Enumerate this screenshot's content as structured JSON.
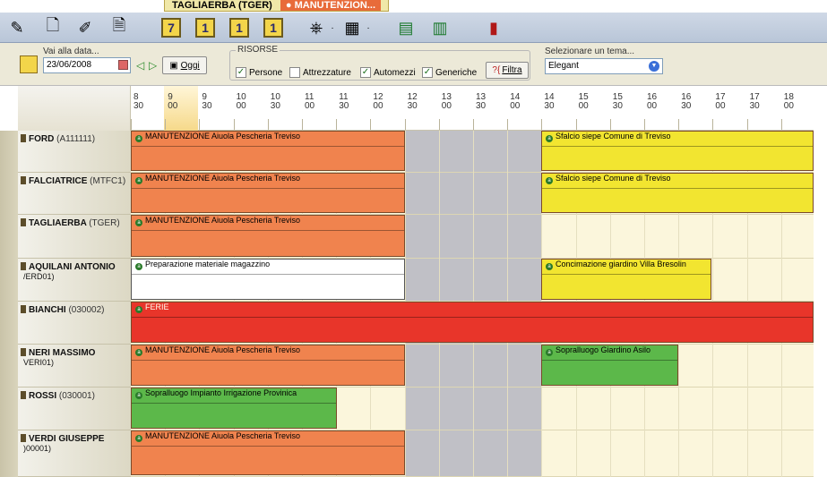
{
  "drag_tab": {
    "resource": "TAGLIAERBA (TGER)",
    "event": "MANUTENZION..."
  },
  "toolbar": {
    "icons": [
      "notepad-icon",
      "new-icon",
      "edit-icon",
      "page-icon",
      "view-week-icon",
      "view-day-icon",
      "view-day-split-icon",
      "view-day-list-icon",
      "network-icon",
      "grid-view-icon",
      "export-excel-icon",
      "excel-sheet-icon",
      "exit-door-icon"
    ],
    "week_label": "7",
    "day_label": "1"
  },
  "filter": {
    "goto_label": "Vai alla data...",
    "date_value": "23/06/2008",
    "today_label": "Oggi",
    "risorse_title": "RISORSE",
    "checks": [
      {
        "label": "Persone",
        "checked": true
      },
      {
        "label": "Attrezzature",
        "checked": false
      },
      {
        "label": "Automezzi",
        "checked": true
      },
      {
        "label": "Generiche",
        "checked": true
      }
    ],
    "filter_label": "Filtra",
    "theme_label": "Selezionare un tema...",
    "theme_value": "Elegant"
  },
  "times": [
    {
      "h": "8",
      "m": "30"
    },
    {
      "h": "9",
      "m": "00"
    },
    {
      "h": "9",
      "m": "30"
    },
    {
      "h": "10",
      "m": "00"
    },
    {
      "h": "10",
      "m": "30"
    },
    {
      "h": "11",
      "m": "00"
    },
    {
      "h": "11",
      "m": "30"
    },
    {
      "h": "12",
      "m": "00"
    },
    {
      "h": "12",
      "m": "30"
    },
    {
      "h": "13",
      "m": "00"
    },
    {
      "h": "13",
      "m": "30"
    },
    {
      "h": "14",
      "m": "00"
    },
    {
      "h": "14",
      "m": "30"
    },
    {
      "h": "15",
      "m": "00"
    },
    {
      "h": "15",
      "m": "30"
    },
    {
      "h": "16",
      "m": "00"
    },
    {
      "h": "16",
      "m": "30"
    },
    {
      "h": "17",
      "m": "00"
    },
    {
      "h": "17",
      "m": "30"
    },
    {
      "h": "18",
      "m": "00"
    }
  ],
  "resources": [
    {
      "name": "FORD",
      "code": "(A111111)",
      "sub": ""
    },
    {
      "name": "FALCIATRICE",
      "code": "(MTFC1)",
      "sub": ""
    },
    {
      "name": "TAGLIAERBA",
      "code": "(TGER)",
      "sub": ""
    },
    {
      "name": "AQUILANI ANTONIO",
      "code": "",
      "sub": "/ERD01)"
    },
    {
      "name": "BIANCHI",
      "code": "(030002)",
      "sub": ""
    },
    {
      "name": "NERI MASSIMO",
      "code": "",
      "sub": "VERI01)"
    },
    {
      "name": "ROSSI",
      "code": "(030001)",
      "sub": ""
    },
    {
      "name": "VERDI GIUSEPPE",
      "code": "",
      "sub": ")00001)"
    }
  ],
  "events": [
    {
      "row": 0,
      "text": "MANUTENZIONE Aiuola Pescheria Treviso",
      "color": "#f0834e"
    },
    {
      "row": 0,
      "text": "Sfalcio siepe Comune di Treviso",
      "color": "#f2e530"
    },
    {
      "row": 1,
      "text": "MANUTENZIONE Aiuola Pescheria Treviso",
      "color": "#f0834e"
    },
    {
      "row": 1,
      "text": "Sfalcio siepe Comune di Treviso",
      "color": "#f2e530"
    },
    {
      "row": 2,
      "text": "MANUTENZIONE Aiuola Pescheria Treviso",
      "color": "#f0834e"
    },
    {
      "row": 3,
      "text": "Preparazione materiale magazzino",
      "color": "#ffffff"
    },
    {
      "row": 3,
      "text": "Concimazione giardino Villa Bresolin",
      "color": "#f2e530"
    },
    {
      "row": 4,
      "text": "FERIE",
      "color": "#e8352a"
    },
    {
      "row": 5,
      "text": "MANUTENZIONE Aiuola Pescheria Treviso",
      "color": "#f0834e"
    },
    {
      "row": 5,
      "text": "Sopralluogo Giardino Asilo",
      "color": "#5cb84a"
    },
    {
      "row": 6,
      "text": "Sopralluogo Impianto Irrigazione Provinica",
      "color": "#5cb84a"
    },
    {
      "row": 7,
      "text": "MANUTENZIONE Aiuola Pescheria Treviso",
      "color": "#f0834e"
    }
  ]
}
